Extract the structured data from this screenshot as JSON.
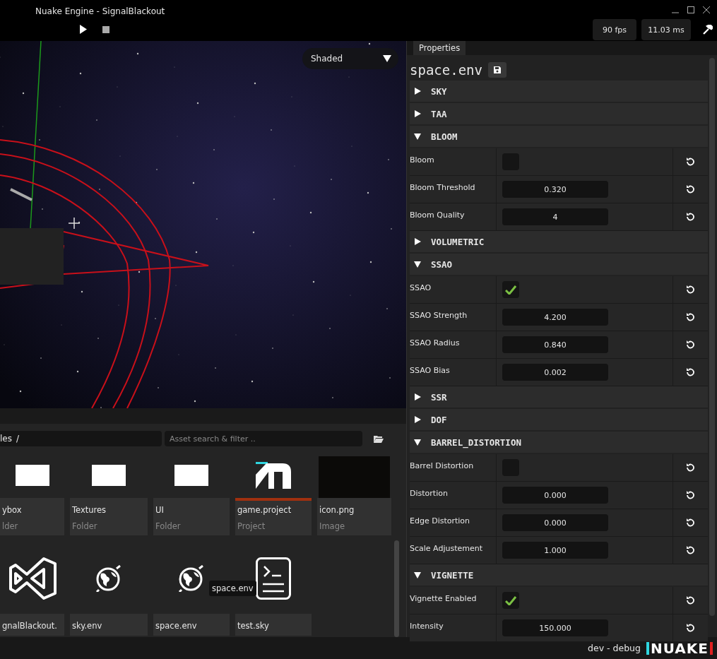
{
  "window": {
    "title": "Nuake Engine - SignalBlackout"
  },
  "toolbar": {
    "fps": "90 fps",
    "frame_time": "11.03 ms"
  },
  "viewport": {
    "shading_mode": "Shaded"
  },
  "asset_browser": {
    "path": "les",
    "path_separator": "/",
    "search": {
      "placeholder": "Asset search & filter .."
    },
    "items": [
      {
        "name": "ybox",
        "type": "lder",
        "kind": "folder",
        "selected": false
      },
      {
        "name": "Textures",
        "type": "Folder",
        "kind": "folder",
        "selected": false
      },
      {
        "name": "UI",
        "type": "Folder",
        "kind": "folder",
        "selected": false
      },
      {
        "name": "game.project",
        "type": "Project",
        "kind": "project",
        "selected": true
      },
      {
        "name": "icon.png",
        "type": "Image",
        "kind": "image",
        "selected": false
      },
      {
        "name": "gnalBlackout.",
        "kind": "solution",
        "selected": false
      },
      {
        "name": "sky.env",
        "kind": "environment",
        "selected": false
      },
      {
        "name": "space.env",
        "kind": "environment",
        "selected": false
      },
      {
        "name": "test.sky",
        "kind": "script",
        "selected": false
      }
    ],
    "tooltip": "space.env"
  },
  "properties": {
    "tab": "Properties",
    "file": "space.env",
    "sections": [
      {
        "name": "SKY",
        "expanded": false
      },
      {
        "name": "TAA",
        "expanded": false
      },
      {
        "name": "BLOOM",
        "expanded": true,
        "fields": [
          {
            "label": "Bloom",
            "kind": "checkbox",
            "checked": false
          },
          {
            "label": "Bloom Threshold",
            "kind": "number",
            "value": "0.320"
          },
          {
            "label": "Bloom Quality",
            "kind": "number",
            "value": "4"
          }
        ]
      },
      {
        "name": "VOLUMETRIC",
        "expanded": false
      },
      {
        "name": "SSAO",
        "expanded": true,
        "fields": [
          {
            "label": "SSAO",
            "kind": "checkbox",
            "checked": true
          },
          {
            "label": "SSAO Strength",
            "kind": "number",
            "value": "4.200"
          },
          {
            "label": "SSAO Radius",
            "kind": "number",
            "value": "0.840"
          },
          {
            "label": "SSAO Bias",
            "kind": "number",
            "value": "0.002"
          }
        ]
      },
      {
        "name": "SSR",
        "expanded": false
      },
      {
        "name": "DOF",
        "expanded": false
      },
      {
        "name": "BARREL_DISTORTION",
        "expanded": true,
        "fields": [
          {
            "label": "Barrel Distortion",
            "kind": "checkbox",
            "checked": false
          },
          {
            "label": "Distortion",
            "kind": "number",
            "value": "0.000"
          },
          {
            "label": "Edge Distortion",
            "kind": "number",
            "value": "0.000"
          },
          {
            "label": "Scale Adjustement",
            "kind": "number",
            "value": "1.000"
          }
        ]
      },
      {
        "name": "VIGNETTE",
        "expanded": true,
        "fields": [
          {
            "label": "Vignette Enabled",
            "kind": "checkbox",
            "checked": true
          },
          {
            "label": "Intensity",
            "kind": "number",
            "value": "150.000"
          }
        ]
      }
    ]
  },
  "status_bar": {
    "build": "dev - debug",
    "logo": "NUAKE"
  }
}
